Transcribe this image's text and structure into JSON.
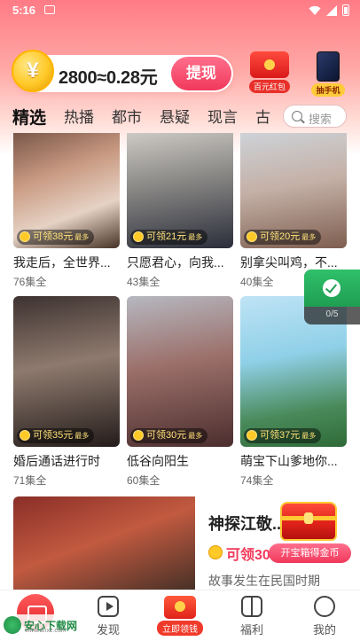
{
  "status_bar": {
    "time": "5:16"
  },
  "header": {
    "coin_icon_text": "¥",
    "coin_balance": "2800≈0.28元",
    "withdraw_label": "提现",
    "promo_red_packet_label": "百元红包",
    "promo_phone_label": "抽手机"
  },
  "tabs": [
    "精选",
    "热播",
    "都市",
    "悬疑",
    "现言",
    "古"
  ],
  "search": {
    "placeholder": "搜索"
  },
  "dramas": [
    {
      "title": "我走后，全世界...",
      "episodes": "76集全",
      "reward": "可领38元",
      "reward_suffix": "最多"
    },
    {
      "title": "只愿君心，向我...",
      "episodes": "43集全",
      "reward": "可领21元",
      "reward_suffix": "最多"
    },
    {
      "title": "别拿尖叫鸡，不...",
      "episodes": "40集全",
      "reward": "可领20元",
      "reward_suffix": "最多"
    },
    {
      "title": "婚后通话进行时",
      "episodes": "71集全",
      "reward": "可领35元",
      "reward_suffix": "最多"
    },
    {
      "title": "低谷向阳生",
      "episodes": "60集全",
      "reward": "可领30元",
      "reward_suffix": "最多"
    },
    {
      "title": "萌宝下山爹地你...",
      "episodes": "74集全",
      "reward": "可领37元",
      "reward_suffix": "最多"
    }
  ],
  "featured": {
    "title": "神探江敬...",
    "reward": "可领30",
    "description": "故事发生在民国时期"
  },
  "task_widget": {
    "progress": "0/5"
  },
  "chest": {
    "button_label": "开宝箱得金币"
  },
  "bottom_nav": {
    "discover": "发现",
    "earn": "立即领钱",
    "welfare": "福利",
    "mine": "我的"
  },
  "watermark": {
    "name": "安心下载网",
    "url": "www.anxz.com"
  },
  "colors": {
    "accent": "#f2385b",
    "coin": "#ffc928",
    "badge_text": "#ffe27a"
  }
}
